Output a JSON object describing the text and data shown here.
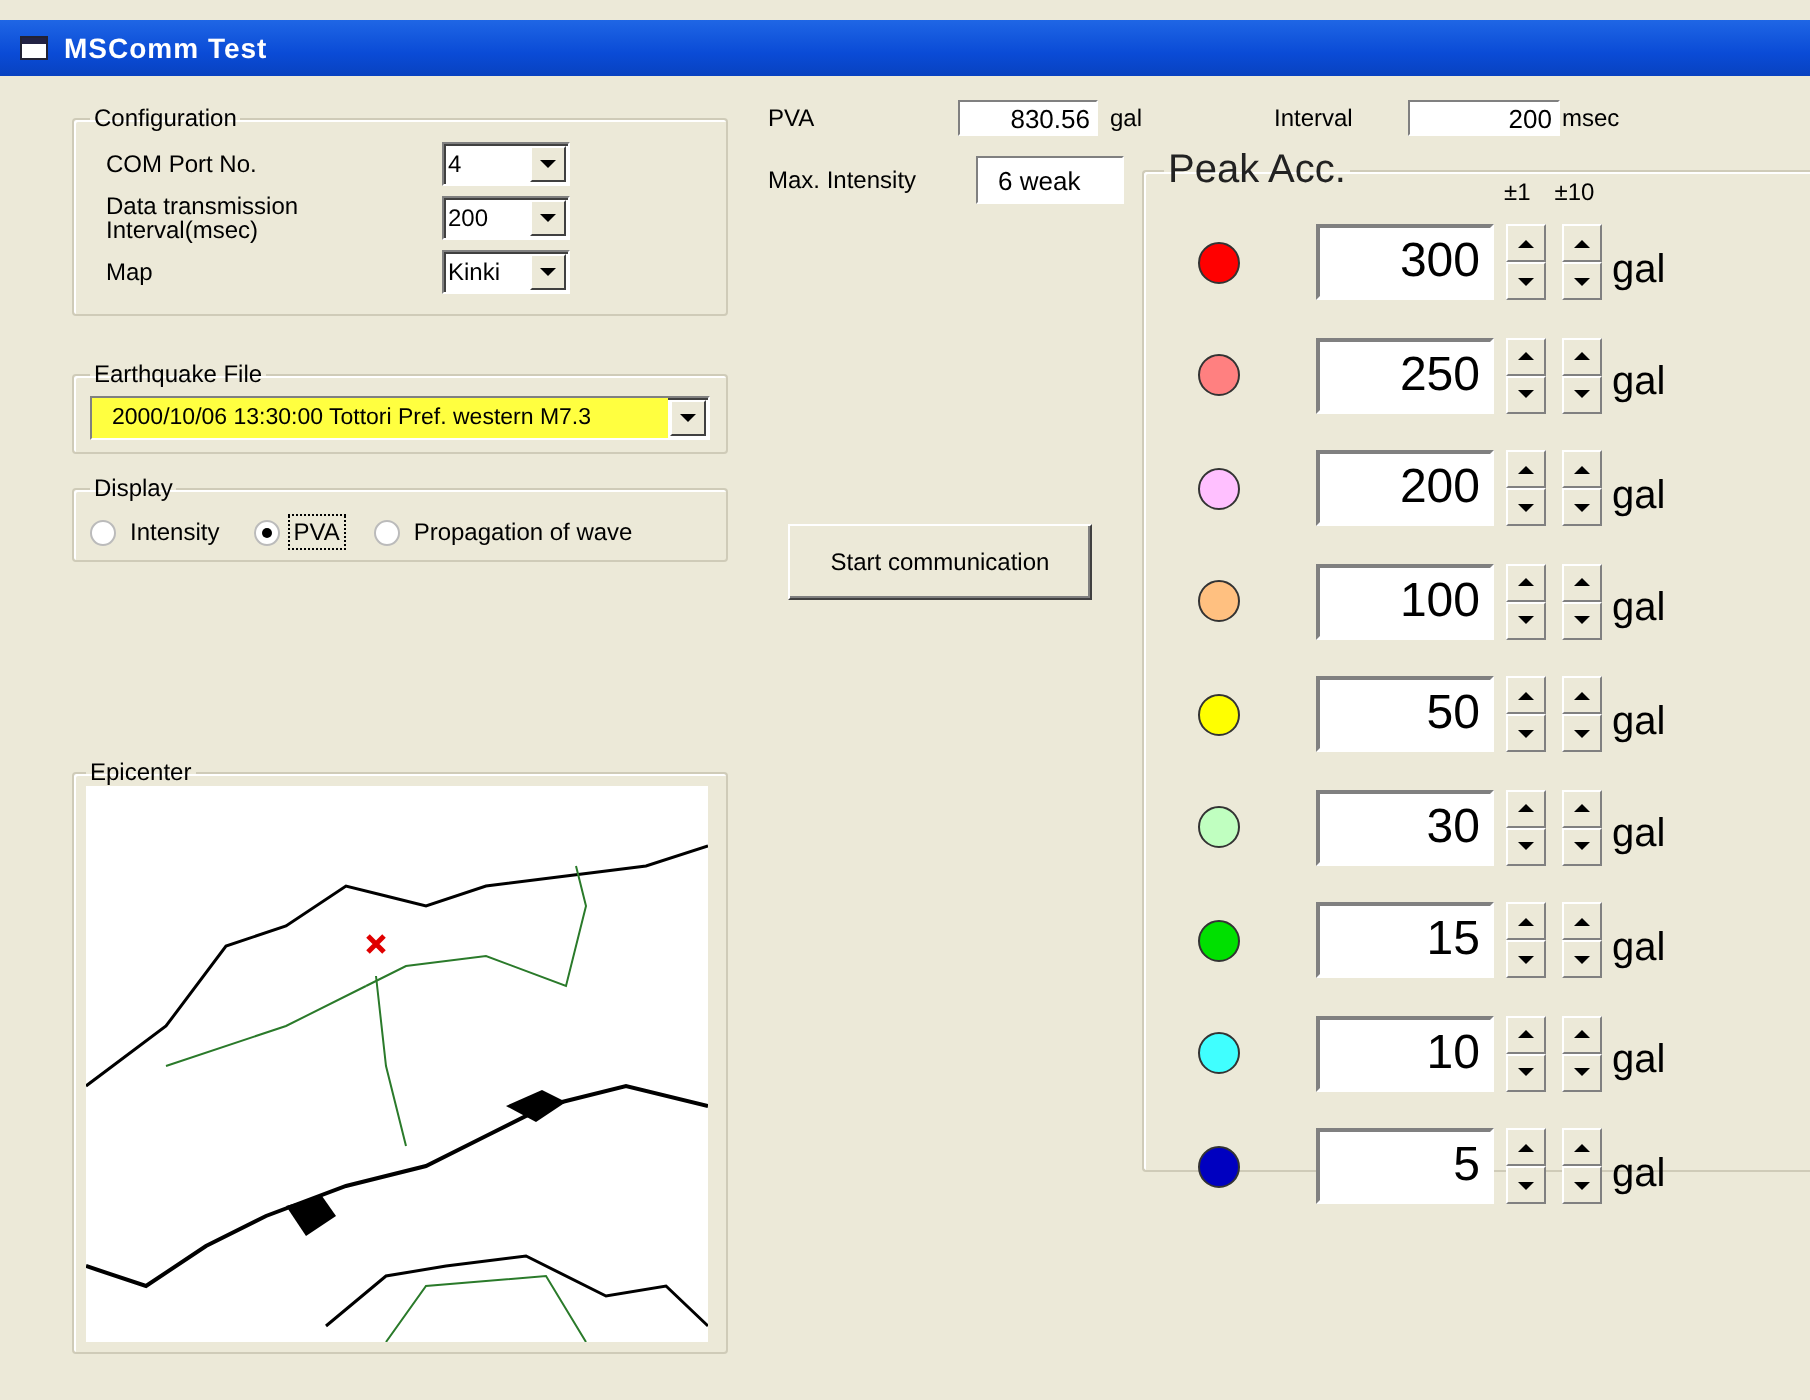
{
  "window": {
    "title": "MSComm Test"
  },
  "configuration": {
    "title": "Configuration",
    "fields": [
      {
        "label": "COM Port No.",
        "value": "4"
      },
      {
        "label": "Data transmission Interval(msec)",
        "value": "200"
      },
      {
        "label": "Map",
        "value": "Kinki"
      }
    ]
  },
  "earthquake_file": {
    "title": "Earthquake File",
    "value": "2000/10/06 13:30:00 Tottori Pref. western M7.3"
  },
  "display": {
    "title": "Display",
    "options": [
      {
        "label": "Intensity",
        "selected": false
      },
      {
        "label": "PVA",
        "selected": true
      },
      {
        "label": "Propagation of wave",
        "selected": false
      }
    ]
  },
  "epicenter": {
    "title": "Epicenter"
  },
  "pva": {
    "label": "PVA",
    "value": "830.56",
    "unit": "gal"
  },
  "max_intensity": {
    "label": "Max. Intensity",
    "value": "6 weak"
  },
  "interval": {
    "label": "Interval",
    "value": "200",
    "unit": "msec"
  },
  "start_button": {
    "label": "Start communication"
  },
  "peak_acc": {
    "title": "Peak Acc.",
    "step_labels": [
      "±1",
      "±10"
    ],
    "rows": [
      {
        "color": "#ff0000",
        "value": "300",
        "unit": "gal"
      },
      {
        "color": "#ff8080",
        "value": "250",
        "unit": "gal"
      },
      {
        "color": "#ffc0ff",
        "value": "200",
        "unit": "gal"
      },
      {
        "color": "#ffc080",
        "value": "100",
        "unit": "gal"
      },
      {
        "color": "#ffff00",
        "value": "50",
        "unit": "gal"
      },
      {
        "color": "#c0ffc0",
        "value": "30",
        "unit": "gal"
      },
      {
        "color": "#00e000",
        "value": "15",
        "unit": "gal"
      },
      {
        "color": "#40ffff",
        "value": "10",
        "unit": "gal"
      },
      {
        "color": "#0000c0",
        "value": "5",
        "unit": "gal"
      }
    ]
  }
}
